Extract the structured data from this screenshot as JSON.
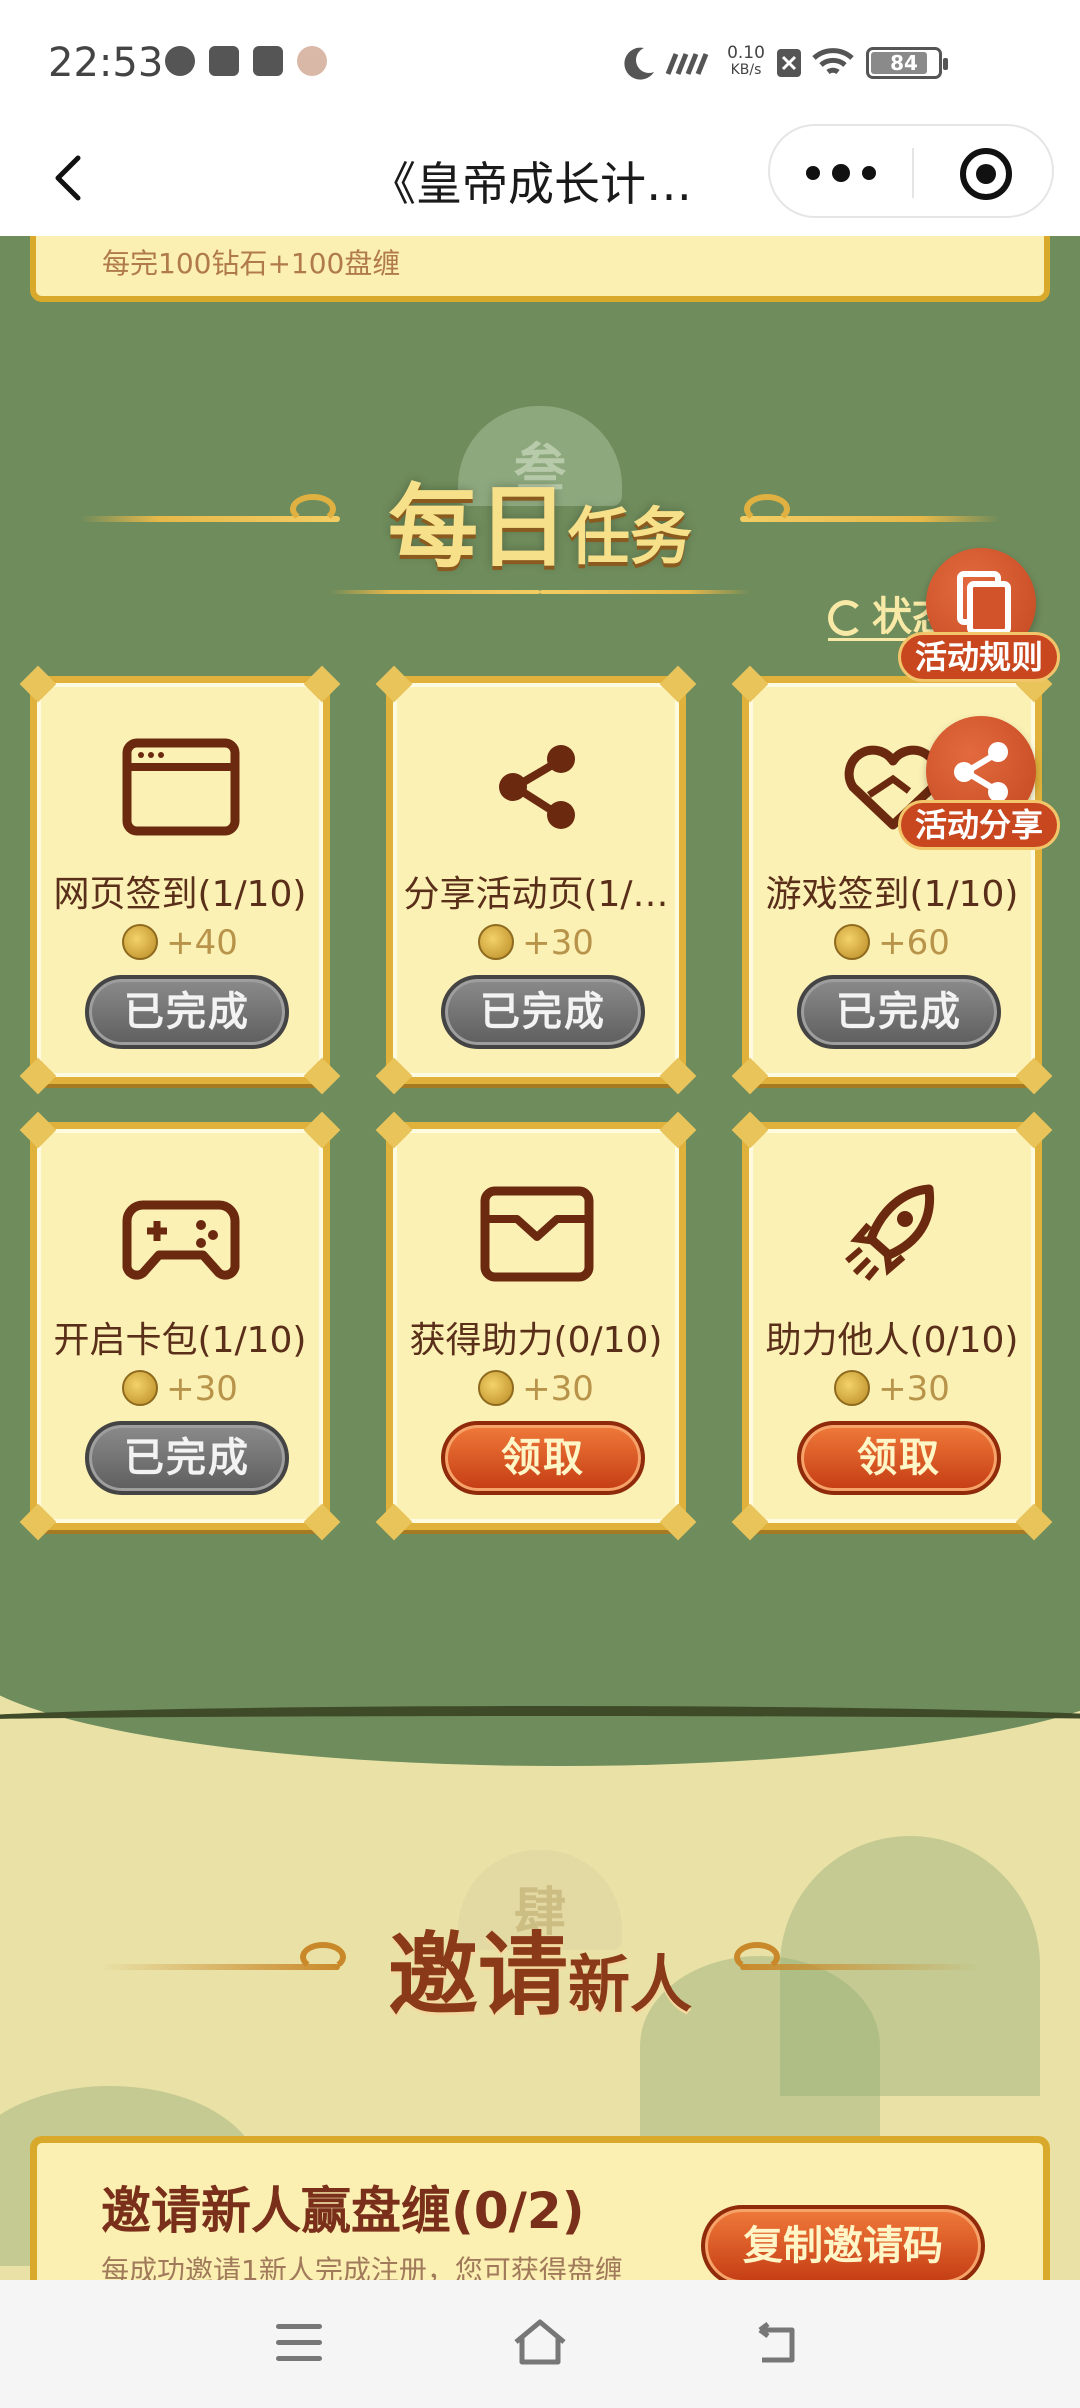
{
  "status_bar": {
    "time": "22:53",
    "net_speed_value": "0.10",
    "net_speed_unit": "KB/s",
    "battery_level": "84"
  },
  "nav": {
    "title": "《皇帝成长计…"
  },
  "prev_section": {
    "text": "每完100钻石+100盘缠"
  },
  "daily_tasks": {
    "watermark": "叁",
    "title_big": "每日",
    "title_small": "任务",
    "refresh_label": "状态刷新",
    "tasks": [
      {
        "name": "网页签到(1/10)",
        "reward": "+40",
        "button": "已完成",
        "state": "done",
        "icon": "browser-window-icon"
      },
      {
        "name": "分享活动页(1/…",
        "reward": "+30",
        "button": "已完成",
        "state": "done",
        "icon": "share-icon"
      },
      {
        "name": "游戏签到(1/10)",
        "reward": "+60",
        "button": "已完成",
        "state": "done",
        "icon": "heart-hand-icon"
      },
      {
        "name": "开启卡包(1/10)",
        "reward": "+30",
        "button": "已完成",
        "state": "done",
        "icon": "gamepad-icon"
      },
      {
        "name": "获得助力(0/10)",
        "reward": "+30",
        "button": "领取",
        "state": "claim",
        "icon": "wallet-icon"
      },
      {
        "name": "助力他人(0/10)",
        "reward": "+30",
        "button": "领取",
        "state": "claim",
        "icon": "rocket-icon"
      }
    ]
  },
  "floating": {
    "rules_label": "活动规则",
    "share_label": "活动分享"
  },
  "invite": {
    "watermark": "肆",
    "title_big": "邀请",
    "title_small": "新人",
    "heading": "邀请新人赢盘缠(0/2)",
    "desc": "每成功邀请1新人完成注册，您可获得盘缠",
    "copy_button": "复制邀请码"
  },
  "colors": {
    "background_green": "#6f8c5c",
    "card_fill": "#fcf1b5",
    "card_border": "#e0b13b",
    "claim_button": "#c43c14",
    "done_button": "#5e5e5e",
    "icon_brown": "#6b2a10"
  }
}
